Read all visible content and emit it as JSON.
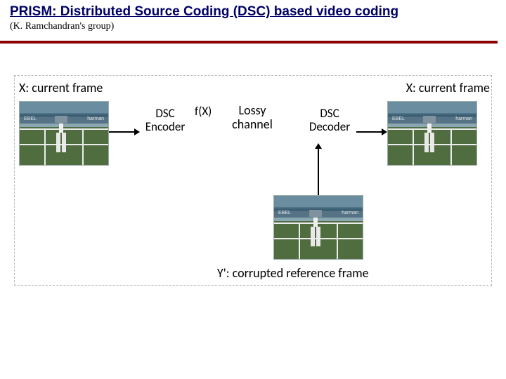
{
  "header": {
    "title": "PRISM: Distributed Source Coding (DSC) based video coding",
    "subtitle": "(K. Ramchandran's group)"
  },
  "diagram": {
    "label_x_left": "X: current frame",
    "label_x_right": "X: current frame",
    "encoder_line1": "DSC",
    "encoder_line2": "Encoder",
    "fx": "f(X)",
    "channel_line1": "Lossy",
    "channel_line2": "channel",
    "decoder_line1": "DSC",
    "decoder_line2": "Decoder",
    "label_y": "Y': corrupted reference frame",
    "banner_left": "EBEL",
    "banner_right": "harman"
  }
}
